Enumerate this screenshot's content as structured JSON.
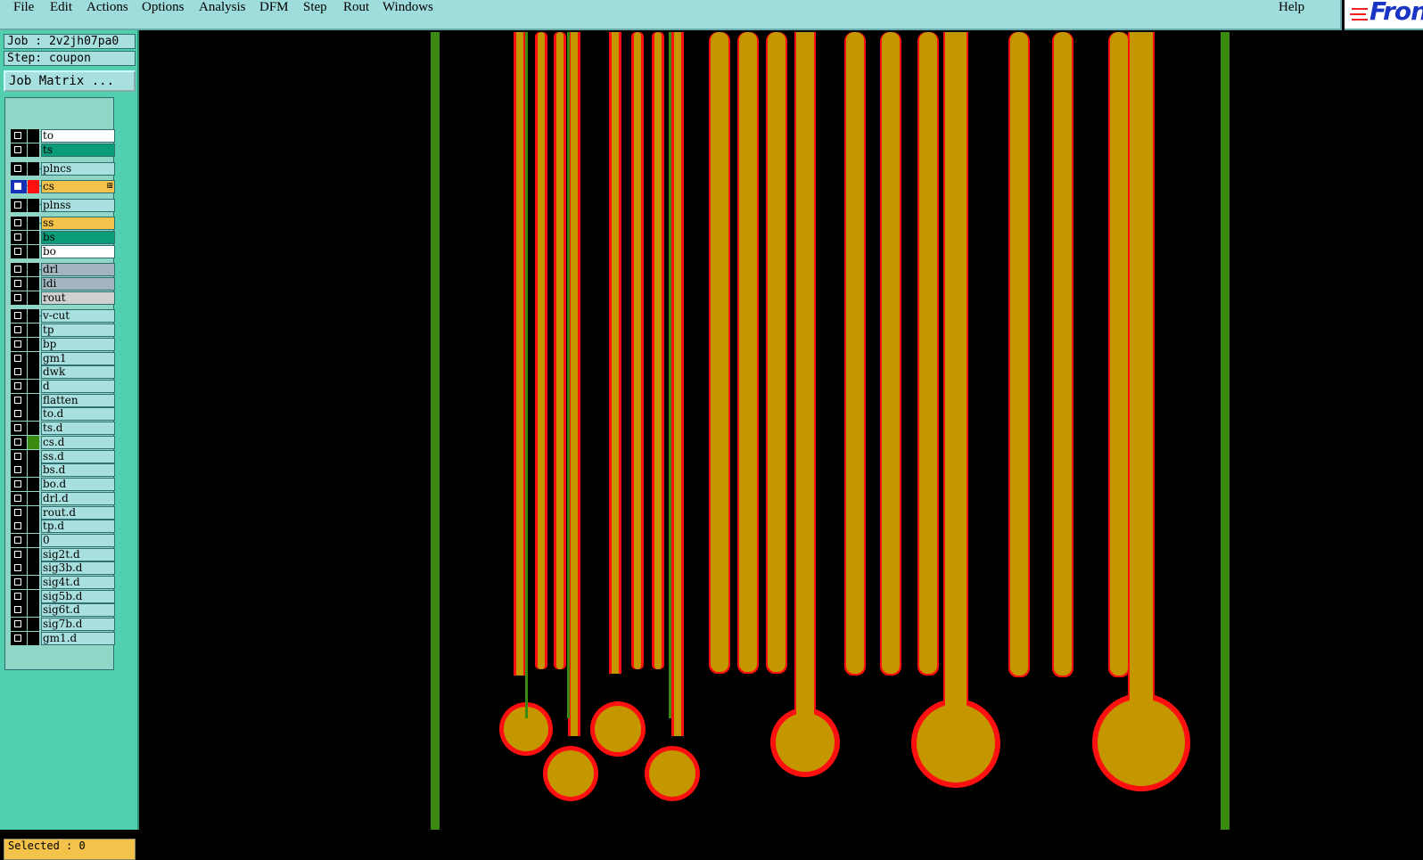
{
  "menubar": {
    "items": [
      {
        "label": "File"
      },
      {
        "label": "Edit"
      },
      {
        "label": "Actions"
      },
      {
        "label": "Options"
      },
      {
        "label": "Analysis"
      },
      {
        "label": "DFM"
      },
      {
        "label": "Step"
      },
      {
        "label": "Rout"
      },
      {
        "label": "Windows"
      }
    ],
    "help_label": "Help"
  },
  "logo": {
    "text": "Fron",
    "icon": "frontline-logo"
  },
  "job": {
    "job_label": "Job : 2v2jh07pa0",
    "step_label": "Step: coupon"
  },
  "job_matrix_label": "Job Matrix ...",
  "layers": [
    {
      "name": "to",
      "color": "#ffffff",
      "checked": false
    },
    {
      "name": "ts",
      "color": "#0a9c78",
      "checked": false
    },
    {
      "name": "plncs",
      "color": "#a8e0df",
      "checked": false
    },
    {
      "name": "cs",
      "color": "#f2c24a",
      "checked": true,
      "swatch": "#ff1010",
      "active": true
    },
    {
      "name": "plnss",
      "color": "#a8e0df",
      "checked": false
    },
    {
      "name": "ss",
      "color": "#f2c24a",
      "checked": false
    },
    {
      "name": "bs",
      "color": "#0a9c78",
      "checked": false
    },
    {
      "name": "bo",
      "color": "#ffffff",
      "checked": false
    },
    {
      "name": "drl",
      "color": "#a3b6c0",
      "checked": false
    },
    {
      "name": "ldi",
      "color": "#a3b6c0",
      "checked": false
    },
    {
      "name": "rout",
      "color": "#d0d0d0",
      "checked": false
    },
    {
      "name": "v-cut",
      "color": "#a8e0df",
      "checked": false
    },
    {
      "name": "tp",
      "color": "#a8e0df",
      "checked": false
    },
    {
      "name": "bp",
      "color": "#a8e0df",
      "checked": false
    },
    {
      "name": "gm1",
      "color": "#a8e0df",
      "checked": false
    },
    {
      "name": "dwk",
      "color": "#a8e0df",
      "checked": false
    },
    {
      "name": "d",
      "color": "#a8e0df",
      "checked": false
    },
    {
      "name": "flatten",
      "color": "#a8e0df",
      "checked": false
    },
    {
      "name": "to.d",
      "color": "#a8e0df",
      "checked": false
    },
    {
      "name": "ts.d",
      "color": "#a8e0df",
      "checked": false
    },
    {
      "name": "cs.d",
      "color": "#a8e0df",
      "checked": false,
      "swatch": "#3a8a10"
    },
    {
      "name": "ss.d",
      "color": "#a8e0df",
      "checked": false
    },
    {
      "name": "bs.d",
      "color": "#a8e0df",
      "checked": false
    },
    {
      "name": "bo.d",
      "color": "#a8e0df",
      "checked": false
    },
    {
      "name": "drl.d",
      "color": "#a8e0df",
      "checked": false
    },
    {
      "name": "rout.d",
      "color": "#a8e0df",
      "checked": false
    },
    {
      "name": "tp.d",
      "color": "#a8e0df",
      "checked": false
    },
    {
      "name": "0",
      "color": "#a8e0df",
      "checked": false
    },
    {
      "name": "sig2t.d",
      "color": "#a8e0df",
      "checked": false
    },
    {
      "name": "sig3b.d",
      "color": "#a8e0df",
      "checked": false
    },
    {
      "name": "sig4t.d",
      "color": "#a8e0df",
      "checked": false
    },
    {
      "name": "sig5b.d",
      "color": "#a8e0df",
      "checked": false
    },
    {
      "name": "sig6t.d",
      "color": "#a8e0df",
      "checked": false
    },
    {
      "name": "sig7b.d",
      "color": "#a8e0df",
      "checked": false
    },
    {
      "name": "gm1.d",
      "color": "#a8e0df",
      "checked": false
    }
  ],
  "status": {
    "selected_label": "Selected : 0"
  },
  "colors": {
    "copper": "#c49600",
    "outline": "#ff1010",
    "drill_green": "#3a8a10",
    "background": "#000000"
  }
}
